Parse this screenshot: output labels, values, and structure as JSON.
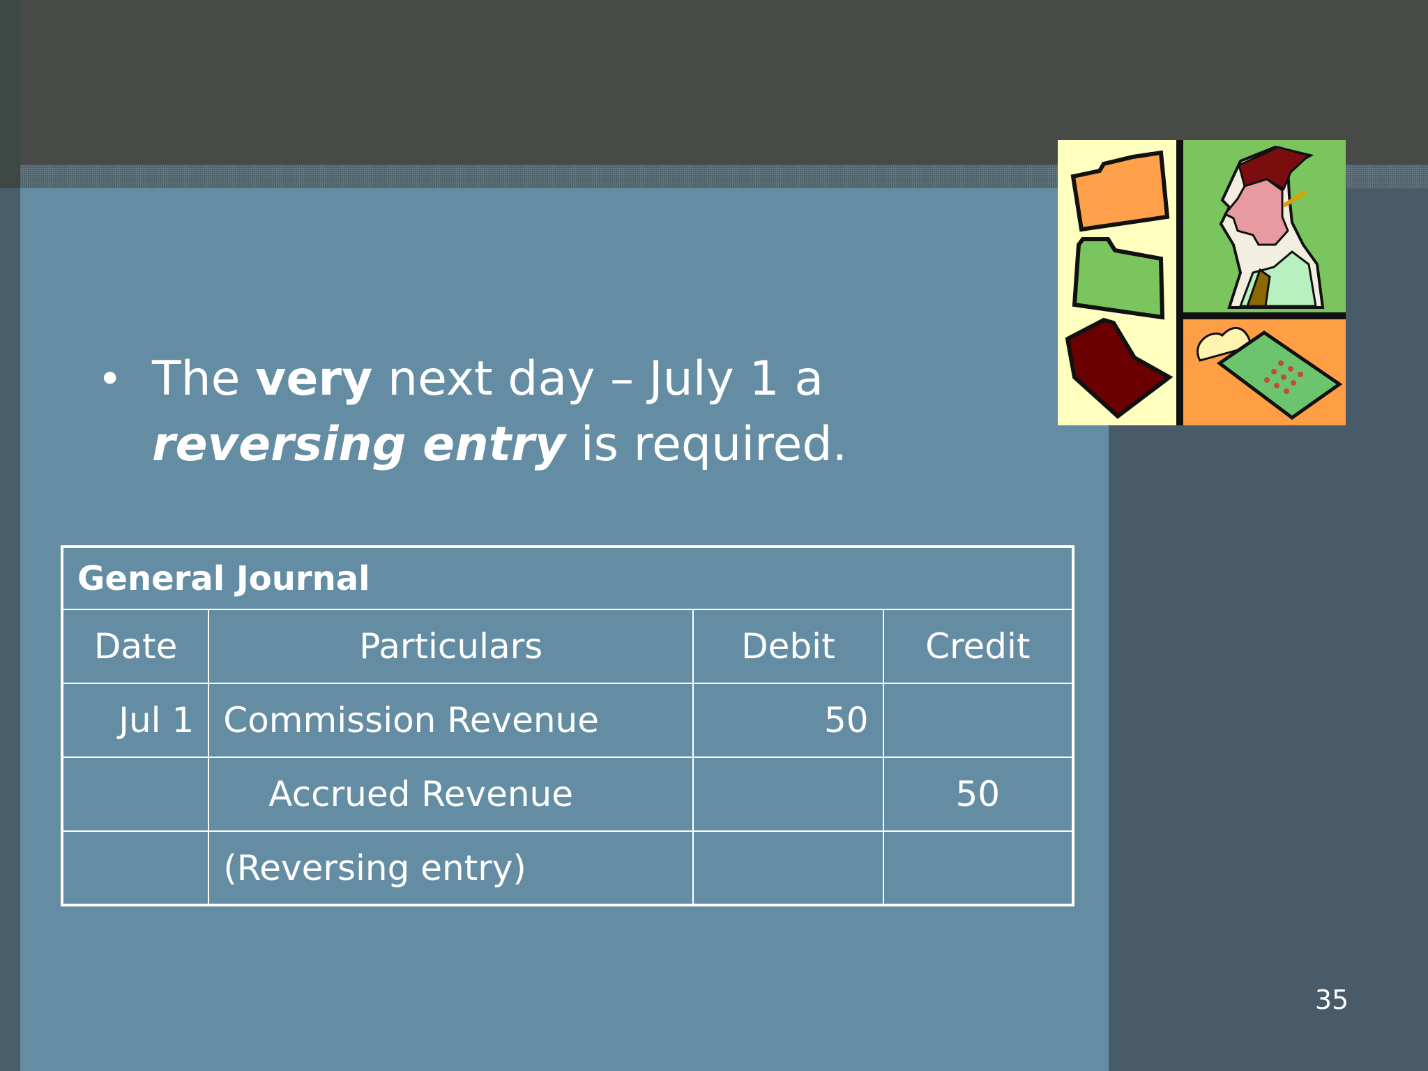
{
  "bullet": {
    "part1": "The ",
    "bold1": "very",
    "part2": " next day – July 1 a ",
    "bold_italic1": "reversing entry",
    "part3": " is required."
  },
  "journal": {
    "title": "General Journal",
    "headers": [
      "Date",
      "Particulars",
      "Debit",
      "Credit"
    ],
    "rows": [
      {
        "date": "Jul 1",
        "particulars": "Commission Revenue",
        "debit": "50",
        "credit": ""
      },
      {
        "date": "",
        "particulars": "Accrued Revenue",
        "debit": "",
        "credit": "50"
      },
      {
        "date": "",
        "particulars": "(Reversing entry)",
        "debit": "",
        "credit": ""
      }
    ]
  },
  "page_number": "35",
  "clipart": {
    "icon": "office-clipart-folders-person-calculator",
    "colors": {
      "panel_yellow": "#ffffc0",
      "panel_green": "#7ac55e",
      "panel_orange": "#ff9f45",
      "folder_orange": "#ffa04a",
      "folder_green": "#7ac55e",
      "folder_red": "#6b0000"
    }
  },
  "colors": {
    "content_bg": "#648da3",
    "top_band": "#474a47",
    "side_panel": "#495b68",
    "text": "#ffffff"
  }
}
